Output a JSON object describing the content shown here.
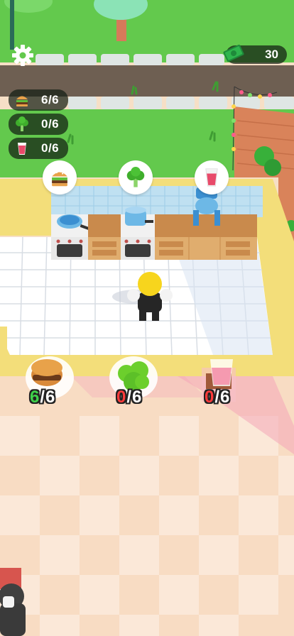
{
  "hud": {
    "settings_icon": "gear-icon",
    "money": {
      "icon": "cash-icon",
      "value": "30"
    },
    "inventory": [
      {
        "icon": "burger-icon",
        "value": "6/6"
      },
      {
        "icon": "broccoli-icon",
        "value": "0/6"
      },
      {
        "icon": "juice-icon",
        "value": "0/6"
      }
    ]
  },
  "stations": [
    {
      "icon": "burger-icon"
    },
    {
      "icon": "broccoli-icon"
    },
    {
      "icon": "juice-icon"
    }
  ],
  "counters": [
    {
      "item": "burger",
      "have": "6",
      "sep": "/",
      "max": "6",
      "status_color": "#3fd24a"
    },
    {
      "item": "broccoli",
      "have": "0",
      "sep": "/",
      "max": "6",
      "status_color": "#ff3b3b"
    },
    {
      "item": "juice",
      "have": "0",
      "sep": "/",
      "max": "6",
      "status_color": "#ff3b3b"
    }
  ],
  "colors": {
    "grass": "#63c94d",
    "road": "#6e5f52",
    "floor_tile": "#ffffff",
    "dining_floor": "#f8dcc3",
    "wall": "#f3de7a",
    "counter_wood": "#c98a4c"
  }
}
